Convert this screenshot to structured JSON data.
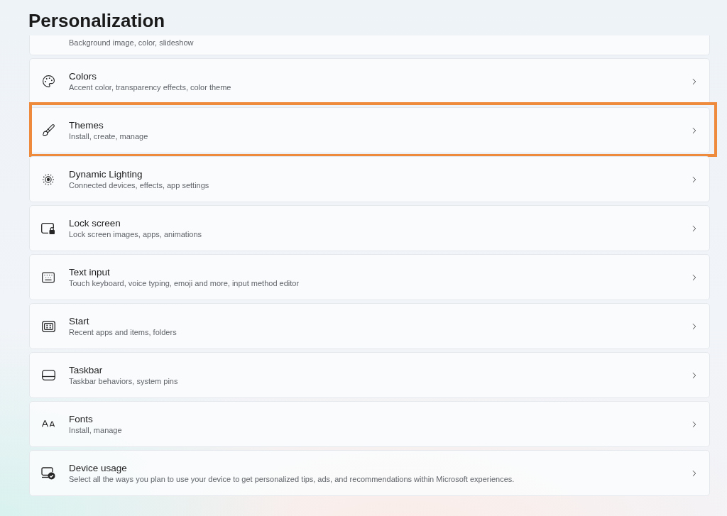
{
  "page": {
    "title": "Personalization"
  },
  "partial_item": {
    "subtitle": "Background image, color, slideshow"
  },
  "items": [
    {
      "kind": "colors",
      "title": "Colors",
      "subtitle": "Accent color, transparency effects, color theme",
      "highlighted": false
    },
    {
      "kind": "themes",
      "title": "Themes",
      "subtitle": "Install, create, manage",
      "highlighted": true
    },
    {
      "kind": "lighting",
      "title": "Dynamic Lighting",
      "subtitle": "Connected devices, effects, app settings",
      "highlighted": false
    },
    {
      "kind": "lockscreen",
      "title": "Lock screen",
      "subtitle": "Lock screen images, apps, animations",
      "highlighted": false
    },
    {
      "kind": "textinput",
      "title": "Text input",
      "subtitle": "Touch keyboard, voice typing, emoji and more, input method editor",
      "highlighted": false
    },
    {
      "kind": "start",
      "title": "Start",
      "subtitle": "Recent apps and items, folders",
      "highlighted": false
    },
    {
      "kind": "taskbar",
      "title": "Taskbar",
      "subtitle": "Taskbar behaviors, system pins",
      "highlighted": false
    },
    {
      "kind": "fonts",
      "title": "Fonts",
      "subtitle": "Install, manage",
      "highlighted": false
    },
    {
      "kind": "deviceusage",
      "title": "Device usage",
      "subtitle": "Select all the ways you plan to use your device to get personalized tips, ads, and recommendations within Microsoft experiences.",
      "highlighted": false
    }
  ]
}
